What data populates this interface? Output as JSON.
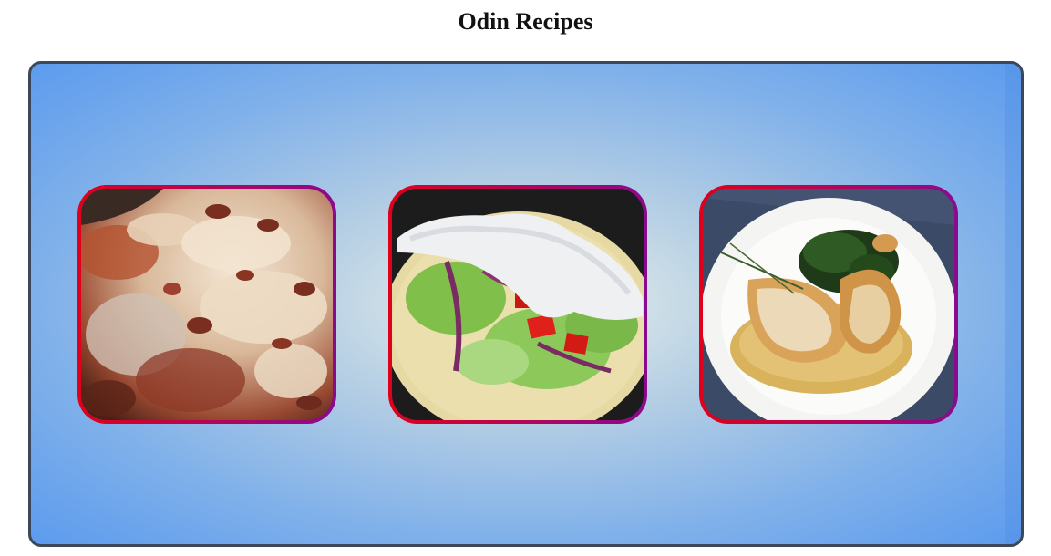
{
  "page": {
    "title": "Odin Recipes"
  },
  "recipes": [
    {
      "image": "lasagna-photo"
    },
    {
      "image": "gyro-photo"
    },
    {
      "image": "roast-chicken-photo"
    }
  ],
  "colors": {
    "frame_border": "#3c4857",
    "gallery_center": "#e8f0ea",
    "gallery_edge": "#5c9bee",
    "card_border_left": "#e0001a",
    "card_border_right": "#8a0a8f"
  }
}
